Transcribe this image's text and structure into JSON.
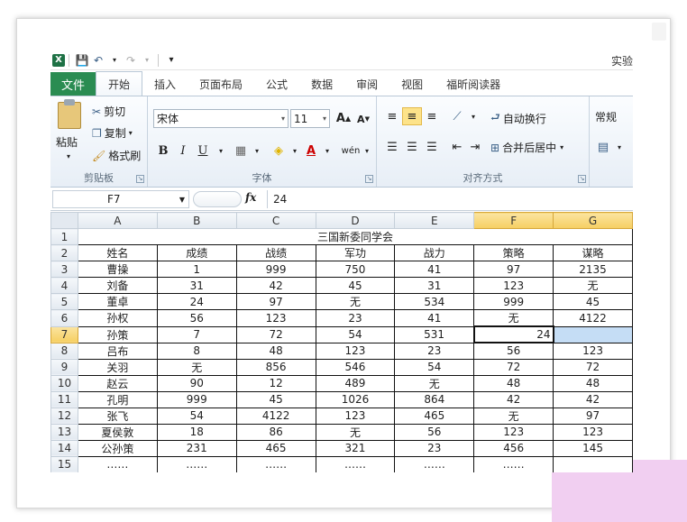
{
  "window": {
    "title_partial": "实验"
  },
  "tabs": {
    "file": "文件",
    "home": "开始",
    "insert": "插入",
    "page_layout": "页面布局",
    "formulas": "公式",
    "data": "数据",
    "review": "审阅",
    "view": "视图",
    "foxit": "福昕阅读器"
  },
  "ribbon": {
    "clipboard": {
      "label": "剪贴板",
      "paste": "粘贴",
      "cut": "剪切",
      "copy": "复制",
      "format_painter": "格式刷"
    },
    "font": {
      "label": "字体",
      "name": "宋体",
      "size": "11",
      "bold": "B",
      "italic": "I",
      "underline": "U"
    },
    "alignment": {
      "label": "对齐方式",
      "wrap_text": "自动换行",
      "merge_center": "合并后居中"
    },
    "number": {
      "format": "常规"
    }
  },
  "formula_bar": {
    "name_box": "F7",
    "fx": "fx",
    "content": "24"
  },
  "sheet": {
    "columns": [
      "A",
      "B",
      "C",
      "D",
      "E",
      "F",
      "G"
    ],
    "row_numbers": [
      "1",
      "2",
      "3",
      "4",
      "5",
      "6",
      "7",
      "8",
      "9",
      "10",
      "11",
      "12",
      "13",
      "14",
      "15"
    ],
    "title": "三国新委同学会",
    "headers": [
      "姓名",
      "成绩",
      "战绩",
      "军功",
      "战力",
      "策略",
      "谋略"
    ],
    "rows": [
      [
        "曹操",
        "1",
        "999",
        "750",
        "41",
        "97",
        "2135"
      ],
      [
        "刘备",
        "31",
        "42",
        "45",
        "31",
        "123",
        "无"
      ],
      [
        "董卓",
        "24",
        "97",
        "无",
        "534",
        "999",
        "45"
      ],
      [
        "孙权",
        "56",
        "123",
        "23",
        "41",
        "无",
        "4122"
      ],
      [
        "孙策",
        "7",
        "72",
        "54",
        "531",
        "24",
        ""
      ],
      [
        "吕布",
        "8",
        "48",
        "123",
        "23",
        "56",
        "123"
      ],
      [
        "关羽",
        "无",
        "856",
        "546",
        "54",
        "72",
        "72"
      ],
      [
        "赵云",
        "90",
        "12",
        "489",
        "无",
        "48",
        "48"
      ],
      [
        "孔明",
        "999",
        "45",
        "1026",
        "864",
        "42",
        "42"
      ],
      [
        "张飞",
        "54",
        "4122",
        "123",
        "465",
        "无",
        "97"
      ],
      [
        "夏侯敦",
        "18",
        "86",
        "无",
        "56",
        "123",
        "123"
      ],
      [
        "公孙策",
        "231",
        "465",
        "321",
        "23",
        "456",
        "145"
      ],
      [
        "……",
        "……",
        "……",
        "……",
        "……",
        "……",
        ""
      ]
    ]
  },
  "colors": {
    "file_tab": "#2a8c52",
    "selection_header": "#f6cf62",
    "selected_fill": "#c5ddf5"
  }
}
